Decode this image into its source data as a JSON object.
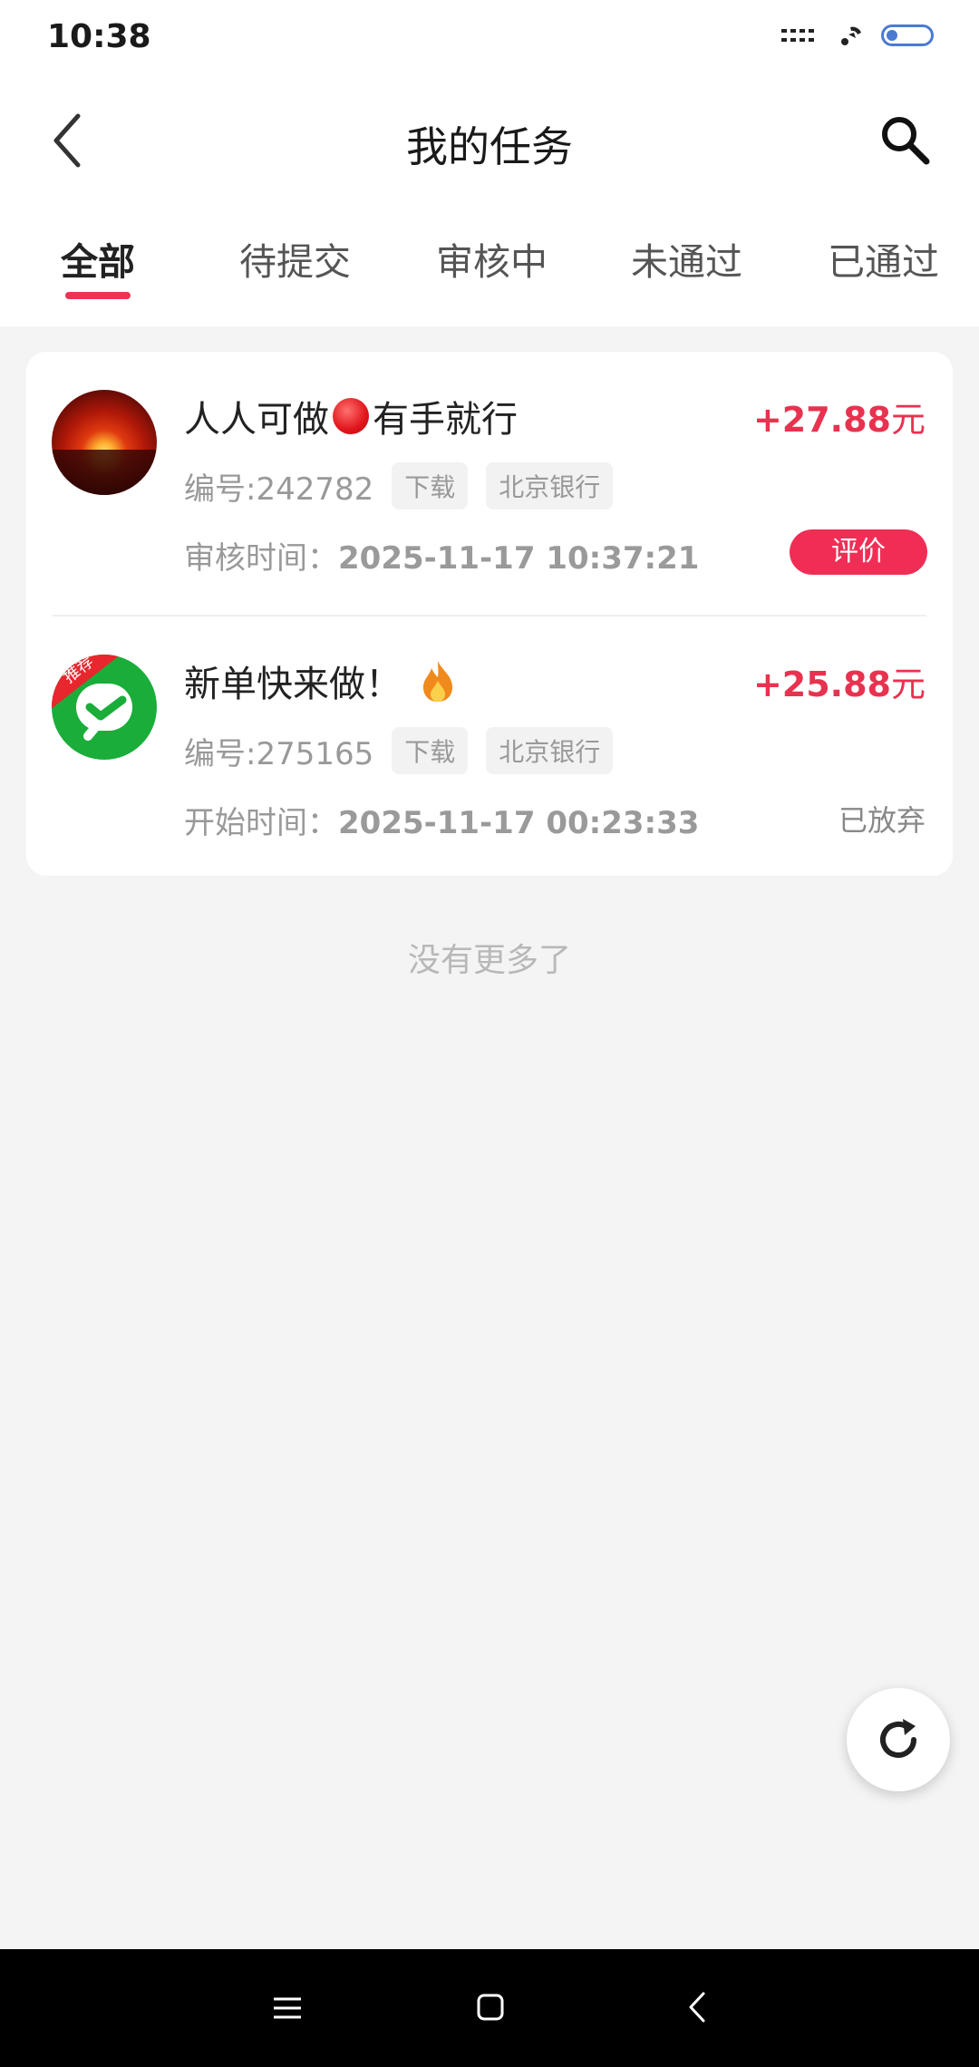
{
  "status_bar": {
    "time": "10:38"
  },
  "header": {
    "title": "我的任务"
  },
  "tabs": [
    {
      "label": "全部",
      "active": true
    },
    {
      "label": "待提交",
      "active": false
    },
    {
      "label": "审核中",
      "active": false
    },
    {
      "label": "未通过",
      "active": false
    },
    {
      "label": "已通过",
      "active": false
    }
  ],
  "tasks": [
    {
      "title_before": "人人可做",
      "title_after": "有手就行",
      "price": "+27.88",
      "price_unit": "元",
      "code": "编号:242782",
      "tags": [
        "下载",
        "北京银行"
      ],
      "time_label": "审核时间：",
      "time_value": "2025-11-17 10:37:21",
      "action": "评价"
    },
    {
      "title_before": "新单快来做！",
      "price": "+25.88",
      "price_unit": "元",
      "code": "编号:275165",
      "tags": [
        "下载",
        "北京银行"
      ],
      "time_label": "开始时间：",
      "time_value": "2025-11-17 00:23:33",
      "status": "已放弃",
      "badge": "推荐"
    }
  ],
  "footer": {
    "no_more": "没有更多了"
  },
  "colors": {
    "accent": "#e8324f",
    "button": "#f02e55",
    "background": "#f4f4f4"
  }
}
